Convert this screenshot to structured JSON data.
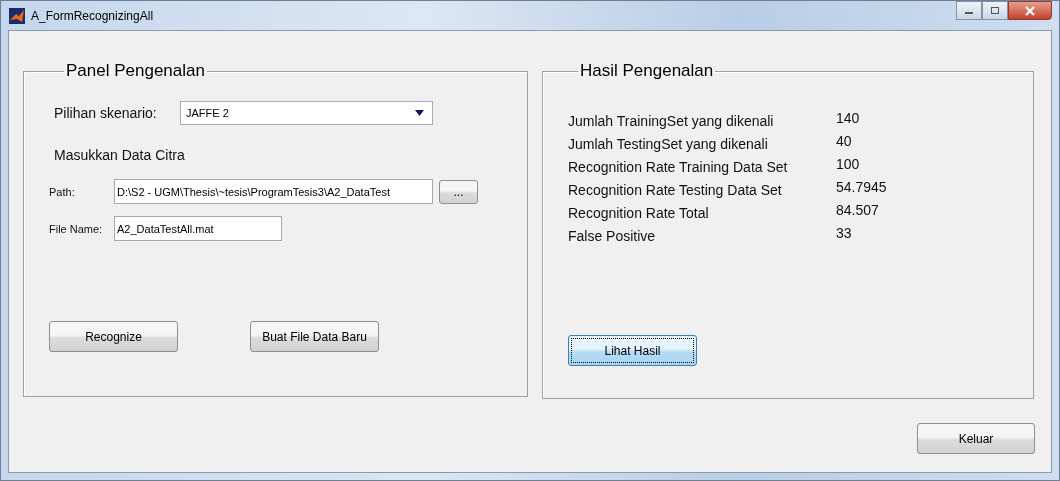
{
  "window": {
    "title": "A_FormRecognizingAll"
  },
  "recognition_panel": {
    "title": "Panel Pengenalan",
    "scenario_label": "Pilihan skenario:",
    "scenario_value": "JAFFE 2",
    "section_label": "Masukkan Data Citra",
    "path_label": "Path:",
    "path_value": "D:\\S2 - UGM\\Thesis\\~tesis\\ProgramTesis3\\A2_DataTest",
    "browse_button": "...",
    "file_name_label": "File Name:",
    "file_name_value": "A2_DataTestAll.mat",
    "buttons": [
      {
        "label": "Recognize",
        "focused": false
      },
      {
        "label": "Buat File Data Baru",
        "focused": false
      }
    ]
  },
  "results_panel": {
    "title": "Hasil Pengenalan",
    "rows": [
      {
        "label": "Jumlah TrainingSet yang dikenali",
        "value": "140"
      },
      {
        "label": "Jumlah TestingSet yang dikenali",
        "value": "40"
      },
      {
        "label": "Recognition Rate Training Data Set",
        "value": "100"
      },
      {
        "label": "Recognition Rate Testing Data Set",
        "value": "54.7945"
      },
      {
        "label": "Recognition Rate Total",
        "value": "84.507"
      },
      {
        "label": "False Positive",
        "value": "33"
      }
    ],
    "button": {
      "label": "Lihat Hasil",
      "focused": true
    }
  },
  "exit_button": {
    "label": "Keluar",
    "focused": false
  }
}
